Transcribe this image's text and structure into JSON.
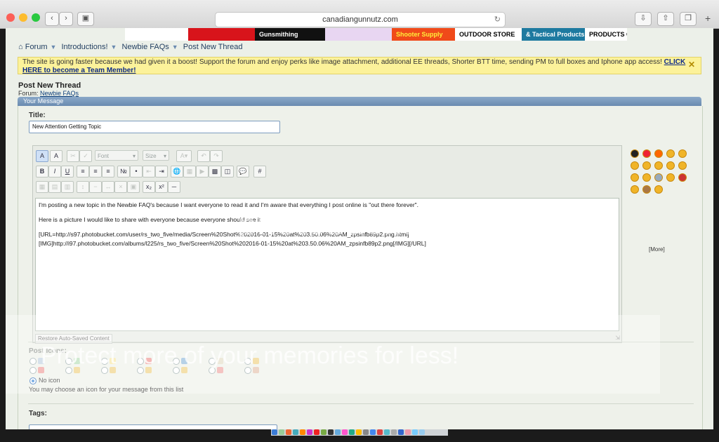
{
  "browser": {
    "address": "canadiangunnutz.com",
    "back_icon": "chevron-left-icon",
    "forward_icon": "chevron-right-icon"
  },
  "ads": [
    {
      "label": "",
      "bg": "#ffffff",
      "color": "#000"
    },
    {
      "label": "",
      "bg": "#d8141b",
      "color": "#fff"
    },
    {
      "label": "Gunsmithing",
      "bg": "#111111",
      "color": "#fff"
    },
    {
      "label": "",
      "bg": "#e8d6f2",
      "color": "#666"
    },
    {
      "label": "Shooter Supply",
      "bg": "#f04a1a",
      "color": "#ffef3a"
    },
    {
      "label": "OUTDOOR STORE",
      "bg": "#ffffff",
      "color": "#000"
    },
    {
      "label": "& Tactical Products",
      "bg": "#1e7aa0",
      "color": "#fff"
    },
    {
      "label": "PRODUCTS CANADA",
      "bg": "#ffffff",
      "color": "#000"
    }
  ],
  "breadcrumb": [
    "Forum",
    "Introductions!",
    "Newbie FAQs",
    "Post New Thread"
  ],
  "notice": {
    "text": "The site is going faster because we had given it a boost! Support the forum and enjoy perks like image attachment, additional EE threads, Shorter BTT time, sending PM to full boxes and Iphone app access! ",
    "link": "CLICK HERE to become a Team Member!"
  },
  "page_title": "Post New Thread",
  "forum_prefix": "Forum: ",
  "forum_name": "Newbie FAQs",
  "panel_title": "Your Message",
  "title_label": "Title:",
  "title_value": "New Attention Getting Topic",
  "toolbar": {
    "font_placeholder": "Font",
    "size_placeholder": "Size"
  },
  "message_lines": [
    "I'm posting a new topic in the Newbie FAQ's because I want everyone to read it and I'm aware that everything I post online is \"out there forever\".",
    "Here is a picture I would like to share with everyone because everyone should see it",
    "[URL=http://s97.photobucket.com/user/rs_two_five/media/Screen%20Shot%202016-01-15%20at%203.50.06%20AM_zpsinfb89p2.png.html]",
    "[IMG]http://i97.photobucket.com/albums/l225/rs_two_five/Screen%20Shot%202016-01-15%20at%203.50.06%20AM_zpsinfb89p2.png[/IMG][/URL]"
  ],
  "restore_label": "Restore Auto-Saved Content",
  "more_label": "[More]",
  "post_icons_label": "Post Icons:",
  "no_icon_label": "No icon",
  "icon_hint": "You may choose an icon for your message from this list",
  "tags_label": "Tags:",
  "watermark_logo": "photobucket",
  "watermark_text": "Protect more of your memories for less!",
  "colors": {
    "accent": "#6a8bb0",
    "notice": "#fcf29a"
  }
}
